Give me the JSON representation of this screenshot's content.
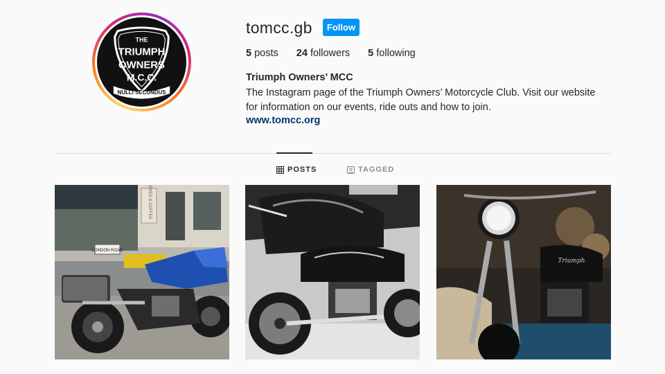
{
  "profile": {
    "username": "tomcc.gb",
    "follow_label": "Follow",
    "stats": {
      "posts_count": "5",
      "posts_label": "posts",
      "followers_count": "24",
      "followers_label": "followers",
      "following_count": "5",
      "following_label": "following"
    },
    "full_name": "Triumph Owners’ MCC",
    "bio": "The Instagram page of the Triumph Owners’ Motorcycle Club. Visit our website for information on our events, ride outs and how to join.",
    "website": "www.tomcc.org",
    "avatar": {
      "logo_line1": "THE",
      "logo_line2": "TRIUMPH",
      "logo_line3": "OWNERS",
      "logo_line4": "M.C.C.",
      "logo_banner": "NULLI SECUNDUS"
    }
  },
  "tabs": [
    {
      "label": "POSTS",
      "icon": "grid-icon",
      "active": true
    },
    {
      "label": "TAGGED",
      "icon": "tag-icon",
      "active": false
    }
  ],
  "posts": [
    {
      "description": "blue adventure motorcycle parked on street",
      "shop_sign": "BIKES & COFFEE",
      "street_sign": "LONDON ROAD"
    },
    {
      "description": "black and white photo of classic motorcycle"
    },
    {
      "description": "dark classic motorcycle with round headlamp",
      "tank_badge": "Triumph"
    }
  ],
  "colors": {
    "accent": "#0095f6",
    "link": "#00376b",
    "text": "#262626",
    "muted": "#8e8e8e",
    "background": "#fafafa"
  }
}
